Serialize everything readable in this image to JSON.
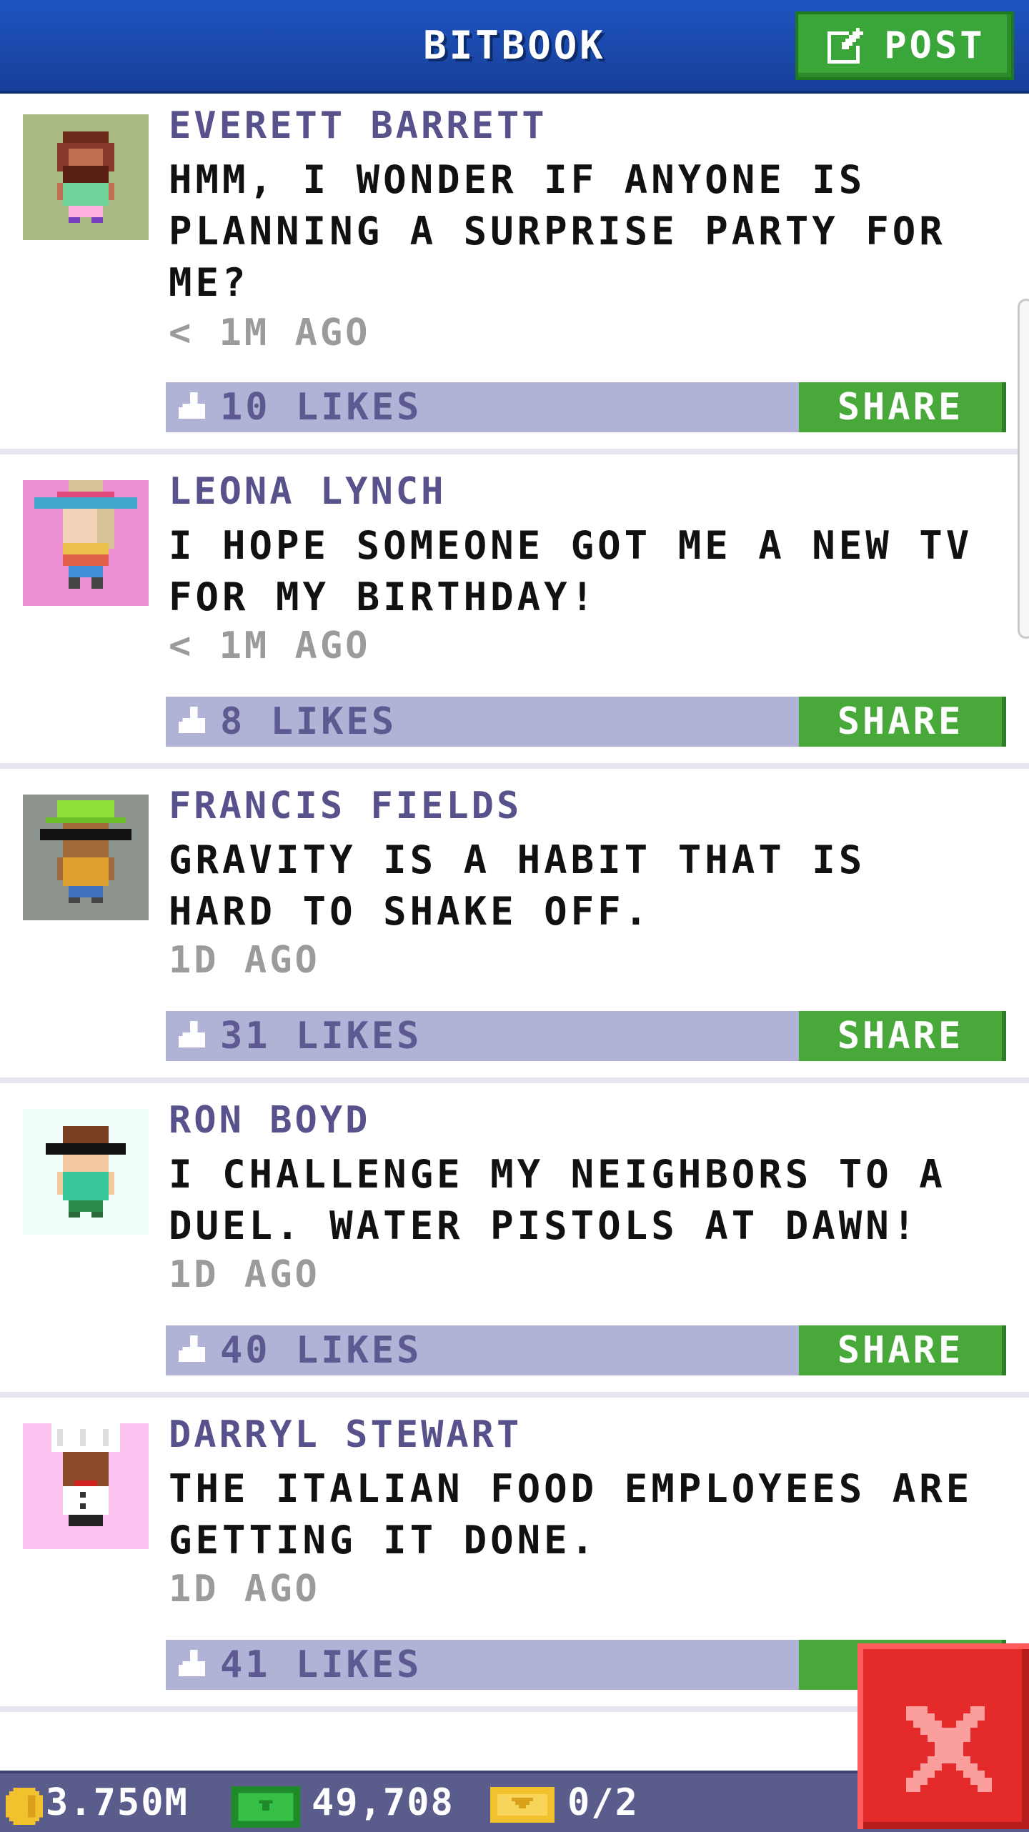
{
  "header": {
    "title": "BITBOOK",
    "post_label": "POST"
  },
  "posts": [
    {
      "name": "EVERETT BARRETT",
      "text": "HMM, I WONDER IF ANYONE IS PLANNING A SURPRISE PARTY FOR ME?",
      "time": "< 1M AGO",
      "likes": "10 LIKES",
      "share": "SHARE",
      "avatar_bg": "#a9bb82"
    },
    {
      "name": "LEONA LYNCH",
      "text": "I HOPE SOMEONE GOT ME A NEW TV FOR MY BIRTHDAY!",
      "time": "< 1M AGO",
      "likes": "8 LIKES",
      "share": "SHARE",
      "avatar_bg": "#ec90d4"
    },
    {
      "name": "FRANCIS FIELDS",
      "text": "GRAVITY IS A HABIT THAT IS HARD TO SHAKE OFF.",
      "time": "1D AGO",
      "likes": "31 LIKES",
      "share": "SHARE",
      "avatar_bg": "#8e948e"
    },
    {
      "name": "RON BOYD",
      "text": "I CHALLENGE MY NEIGHBORS TO A DUEL. WATER PISTOLS AT DAWN!",
      "time": "1D AGO",
      "likes": "40 LIKES",
      "share": "SHARE",
      "avatar_bg": "#f0fdf9"
    },
    {
      "name": "DARRYL STEWART",
      "text": "THE ITALIAN FOOD EMPLOYEES ARE GETTING IT DONE.",
      "time": "1D AGO",
      "likes": "41 LIKES",
      "share": "SH",
      "avatar_bg": "#fbc4f0"
    }
  ],
  "footer": {
    "coins": "3.750M",
    "bux": "49,708",
    "tickets": "0/2"
  },
  "colors": {
    "header_blue": "#1f54c0",
    "green_button": "#48a83a",
    "like_bar": "#b1b3d6",
    "name_purple": "#57528c",
    "close_red": "#e52a2a"
  },
  "icons": [
    "edit-icon",
    "thumb-up-icon",
    "coin-icon",
    "cash-icon",
    "ticket-icon",
    "close-icon"
  ]
}
